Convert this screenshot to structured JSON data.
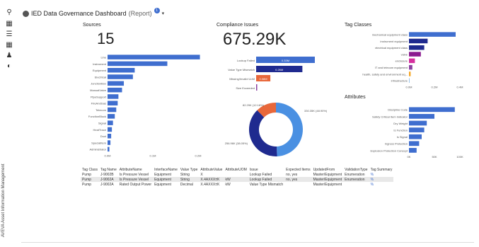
{
  "header": {
    "title": "IED Data Governance Dashboard",
    "subtitle": "(Report)",
    "badge": "1"
  },
  "sidebar": {
    "vertical_label": "AVEVA Asset Information Management",
    "icons": [
      "search-icon",
      "hierarchy-icon",
      "list-icon",
      "table-icon",
      "user-icon",
      "globe-icon"
    ]
  },
  "sources": {
    "title": "Sources",
    "count": "15",
    "chart_data": {
      "type": "bar",
      "categories": [
        "Line",
        "Instrument",
        "Equipment",
        "Electrical",
        "JunctionBox",
        "ManualValve",
        "PipeSupport",
        "FireAndGas",
        "Telecom",
        "FunctionBlock",
        "Signal",
        "HeatTrace",
        "Duct",
        "SpecialItem",
        "Administrator"
      ],
      "values": [
        0.255,
        0.165,
        0.075,
        0.07,
        0.045,
        0.04,
        0.03,
        0.028,
        0.024,
        0.02,
        0.015,
        0.012,
        0.01,
        0.008,
        0.005
      ],
      "ticks": [
        "0.0M",
        "0.1M",
        "0.2M"
      ],
      "xlim": [
        0,
        0.25
      ]
    }
  },
  "compliance": {
    "title": "Compliance Issues",
    "value": "675.29K",
    "chart_data": {
      "type": "bar",
      "categories": [
        "Lookup Failed",
        "Value Type Mismatch",
        "Missing/Invalid UoM",
        "Size Exceeded"
      ],
      "values": [
        0.33,
        0.26,
        0.08,
        0.005
      ],
      "labels": [
        "0.33M",
        "0.26M",
        "0.08M",
        ""
      ],
      "colors": [
        "#3f6ecf",
        "#1f2a8f",
        "#e8673a",
        "#8b3fa0"
      ]
    },
    "donut": {
      "type": "pie",
      "values": [
        330.35,
        256.96,
        82.29
      ],
      "labels": [
        "330.35K (48.90%)",
        "256.96K (38.05%)",
        "82.29K (12.18%)"
      ],
      "colors": [
        "#4a90e2",
        "#1f2a8f",
        "#e8673a"
      ]
    }
  },
  "tag_classes": {
    "title": "Tag Classes",
    "chart_data": {
      "type": "bar",
      "categories": [
        "mechanical equipment class",
        "instrument equipment",
        "electrical equipment class",
        "valve",
        "enclosure",
        "IT and telecom equipment",
        "health, safety and environment eq...",
        "infrastructure"
      ],
      "values": [
        0.55,
        0.22,
        0.18,
        0.14,
        0.07,
        0.04,
        0.02,
        0.005
      ],
      "colors": [
        "#3f6ecf",
        "#1f2a8f",
        "#1f2a8f",
        "#8b1a8f",
        "#d62f9e",
        "#8b3fa0",
        "#f5a623",
        "#7fb3e6"
      ],
      "ticks": [
        "0.0M",
        "0.2M",
        "0.4M"
      ],
      "xlim": [
        0,
        0.6
      ]
    }
  },
  "attributes": {
    "title": "Attributes",
    "chart_data": {
      "type": "bar",
      "categories": [
        "Discipline Code",
        "Safety Critical Item Indicator",
        "Dry Weight",
        "Is Function",
        "Is Signal",
        "Ingress Protection",
        "Explosion Protection Concept"
      ],
      "values": [
        90,
        50,
        35,
        30,
        25,
        20,
        15
      ],
      "ticks": [
        "0K",
        "50K",
        "100K"
      ],
      "xlim": [
        0,
        100
      ]
    }
  },
  "table": {
    "columns": [
      "Tag Class",
      "Tag Name",
      "AttributeName",
      "InterfaceName",
      "Value Type",
      "AttributeValue",
      "AttributeUOM",
      "Issue",
      "Expected Items",
      "UpdatedFrom",
      "ValidationType",
      "Tag Summary"
    ],
    "rows": [
      [
        "Pump",
        "J-9002B",
        "Is Pressure Vessel",
        "Equipment",
        "String",
        "X",
        "",
        "Lookup Failed",
        "no, yes",
        "Master/Equipment",
        "Enumeration",
        "%"
      ],
      [
        "Pump",
        "J-9002A",
        "Is Pressure Vessel",
        "Equipment",
        "String",
        "X.4AXXX±K",
        "kW",
        "Lookup Failed",
        "no, yes",
        "Master/Equipment",
        "Enumeration",
        "%"
      ],
      [
        "Pump",
        "J-9002A",
        "Rated Output Power",
        "Equipment",
        "Decimal",
        "X.4AXXX±K",
        "kW",
        "Value Type Mismatch",
        "",
        "Master/Equipment",
        "",
        "%"
      ]
    ]
  }
}
